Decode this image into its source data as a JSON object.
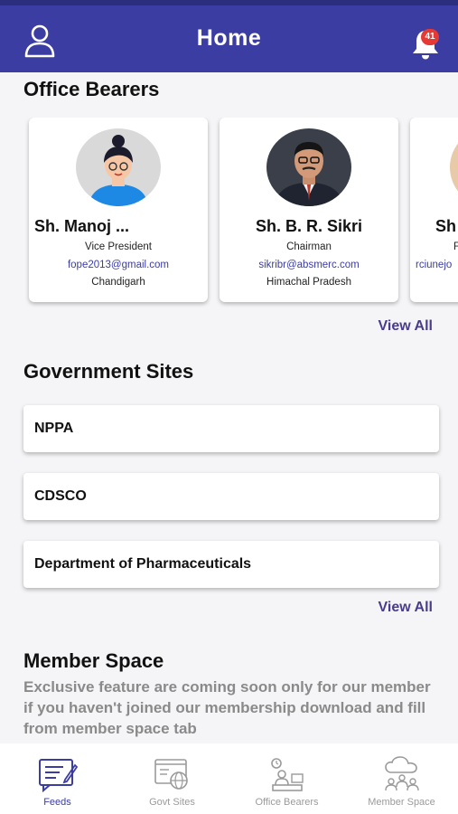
{
  "header": {
    "title": "Home",
    "notification_count": "41"
  },
  "office_bearers": {
    "title": "Office Bearers",
    "view_all": "View All",
    "cards": [
      {
        "name": "Sh. Manoj ...",
        "role": "Vice President",
        "email": "fope2013@gmail.com",
        "location": "Chandigarh"
      },
      {
        "name": "Sh. B. R. Sikri",
        "role": "Chairman",
        "email": "sikribr@absmerc.com",
        "location": "Himachal Pradesh"
      },
      {
        "name": "Sh",
        "role": "F",
        "email": "rciunejo",
        "location": ""
      }
    ]
  },
  "government_sites": {
    "title": "Government Sites",
    "view_all": "View All",
    "items": [
      "NPPA",
      "CDSCO",
      "Department of Pharmaceuticals"
    ]
  },
  "member_space": {
    "title": "Member Space",
    "text": "Exclusive feature are coming soon only for our member if you haven't joined our membership download and fill from member space tab"
  },
  "bottom_nav": {
    "items": [
      {
        "label": "Feeds",
        "icon": "feeds-icon",
        "active": true
      },
      {
        "label": "Govt Sites",
        "icon": "govt-sites-icon",
        "active": false
      },
      {
        "label": "Office Bearers",
        "icon": "office-bearers-icon",
        "active": false
      },
      {
        "label": "Member Space",
        "icon": "member-space-icon",
        "active": false
      }
    ]
  },
  "colors": {
    "header_bg": "#3b3da3",
    "accent": "#4a3c8c",
    "badge": "#e53935",
    "muted_text": "#8a8a8a"
  }
}
